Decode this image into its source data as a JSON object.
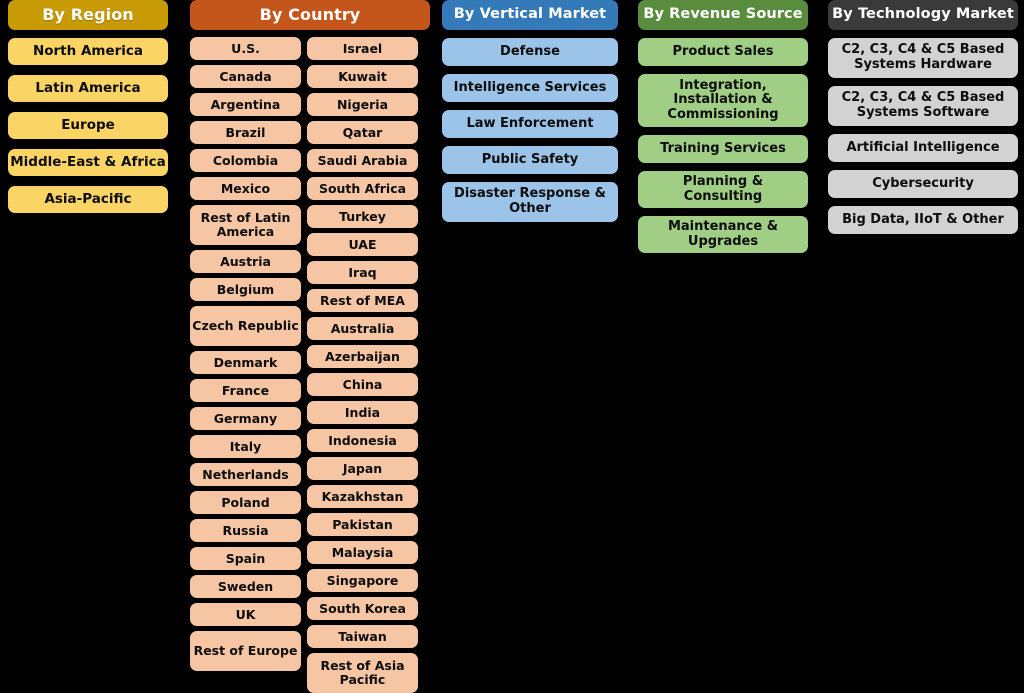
{
  "columns": [
    {
      "id": "region",
      "header": "By Region",
      "header_color": "#C89A06",
      "item_color": "#FAD565",
      "items": [
        {
          "label": "North America",
          "lines": 1
        },
        {
          "label": "Latin America",
          "lines": 1
        },
        {
          "label": "Europe",
          "lines": 1
        },
        {
          "label": "Middle-East & Africa",
          "lines": 1
        },
        {
          "label": "Asia-Pacific",
          "lines": 1
        }
      ]
    },
    {
      "id": "country",
      "header": "By Country",
      "header_color": "#C4551B",
      "item_color": "#F6C6A4",
      "items_left": [
        {
          "label": "U.S.",
          "lines": 1
        },
        {
          "label": "Canada",
          "lines": 1
        },
        {
          "label": "Argentina",
          "lines": 1
        },
        {
          "label": "Brazil",
          "lines": 1
        },
        {
          "label": "Colombia",
          "lines": 1
        },
        {
          "label": "Mexico",
          "lines": 1
        },
        {
          "label": "Rest of Latin America",
          "lines": 2
        },
        {
          "label": "Austria",
          "lines": 1
        },
        {
          "label": "Belgium",
          "lines": 1
        },
        {
          "label": "Czech Republic",
          "lines": 2
        },
        {
          "label": "Denmark",
          "lines": 1
        },
        {
          "label": "France",
          "lines": 1
        },
        {
          "label": "Germany",
          "lines": 1
        },
        {
          "label": "Italy",
          "lines": 1
        },
        {
          "label": "Netherlands",
          "lines": 1
        },
        {
          "label": "Poland",
          "lines": 1
        },
        {
          "label": "Russia",
          "lines": 1
        },
        {
          "label": "Spain",
          "lines": 1
        },
        {
          "label": "Sweden",
          "lines": 1
        },
        {
          "label": "UK",
          "lines": 1
        },
        {
          "label": "Rest of Europe",
          "lines": 2
        }
      ],
      "items_right": [
        {
          "label": "Israel",
          "lines": 1
        },
        {
          "label": "Kuwait",
          "lines": 1
        },
        {
          "label": "Nigeria",
          "lines": 1
        },
        {
          "label": "Qatar",
          "lines": 1
        },
        {
          "label": "Saudi Arabia",
          "lines": 1
        },
        {
          "label": "South Africa",
          "lines": 1
        },
        {
          "label": "Turkey",
          "lines": 1
        },
        {
          "label": "UAE",
          "lines": 1
        },
        {
          "label": "Iraq",
          "lines": 1
        },
        {
          "label": "Rest of MEA",
          "lines": 1
        },
        {
          "label": "Australia",
          "lines": 1
        },
        {
          "label": "Azerbaijan",
          "lines": 1
        },
        {
          "label": "China",
          "lines": 1
        },
        {
          "label": "India",
          "lines": 1
        },
        {
          "label": "Indonesia",
          "lines": 1
        },
        {
          "label": "Japan",
          "lines": 1
        },
        {
          "label": "Kazakhstan",
          "lines": 1
        },
        {
          "label": "Pakistan",
          "lines": 1
        },
        {
          "label": "Malaysia",
          "lines": 1
        },
        {
          "label": "Singapore",
          "lines": 1
        },
        {
          "label": "South Korea",
          "lines": 1
        },
        {
          "label": "Taiwan",
          "lines": 1
        },
        {
          "label": "Rest of Asia Pacific",
          "lines": 2
        }
      ]
    },
    {
      "id": "vertical",
      "header": "By Vertical Market",
      "header_color": "#3479B8",
      "item_color": "#9CC3E8",
      "items": [
        {
          "label": "Defense",
          "lines": 1
        },
        {
          "label": "Intelligence Services",
          "lines": 1
        },
        {
          "label": "Law Enforcement",
          "lines": 1
        },
        {
          "label": "Public Safety",
          "lines": 1
        },
        {
          "label": "Disaster Response & Other",
          "lines": 2
        }
      ]
    },
    {
      "id": "revenue",
      "header": "By  Revenue Source",
      "header_color": "#5A8C3E",
      "item_color": "#A0CE84",
      "items": [
        {
          "label": "Product Sales",
          "lines": 1
        },
        {
          "label": "Integration, Installation & Commissioning",
          "lines": 3
        },
        {
          "label": "Training Services",
          "lines": 1
        },
        {
          "label": "Planning & Consulting",
          "lines": 2
        },
        {
          "label": "Maintenance & Upgrades",
          "lines": 2
        }
      ]
    },
    {
      "id": "technology",
      "header": "By Technology Market",
      "header_color": "#3A3A3A",
      "item_color": "#D2D2D2",
      "items": [
        {
          "label": "C2, C3, C4 & C5 Based Systems Hardware",
          "lines": 2
        },
        {
          "label": "C2, C3, C4 & C5 Based Systems Software",
          "lines": 2
        },
        {
          "label": "Artificial Intelligence",
          "lines": 1
        },
        {
          "label": "Cybersecurity",
          "lines": 1
        },
        {
          "label": "Big Data, IIoT & Other",
          "lines": 1
        }
      ]
    }
  ],
  "background_color": "#000000"
}
